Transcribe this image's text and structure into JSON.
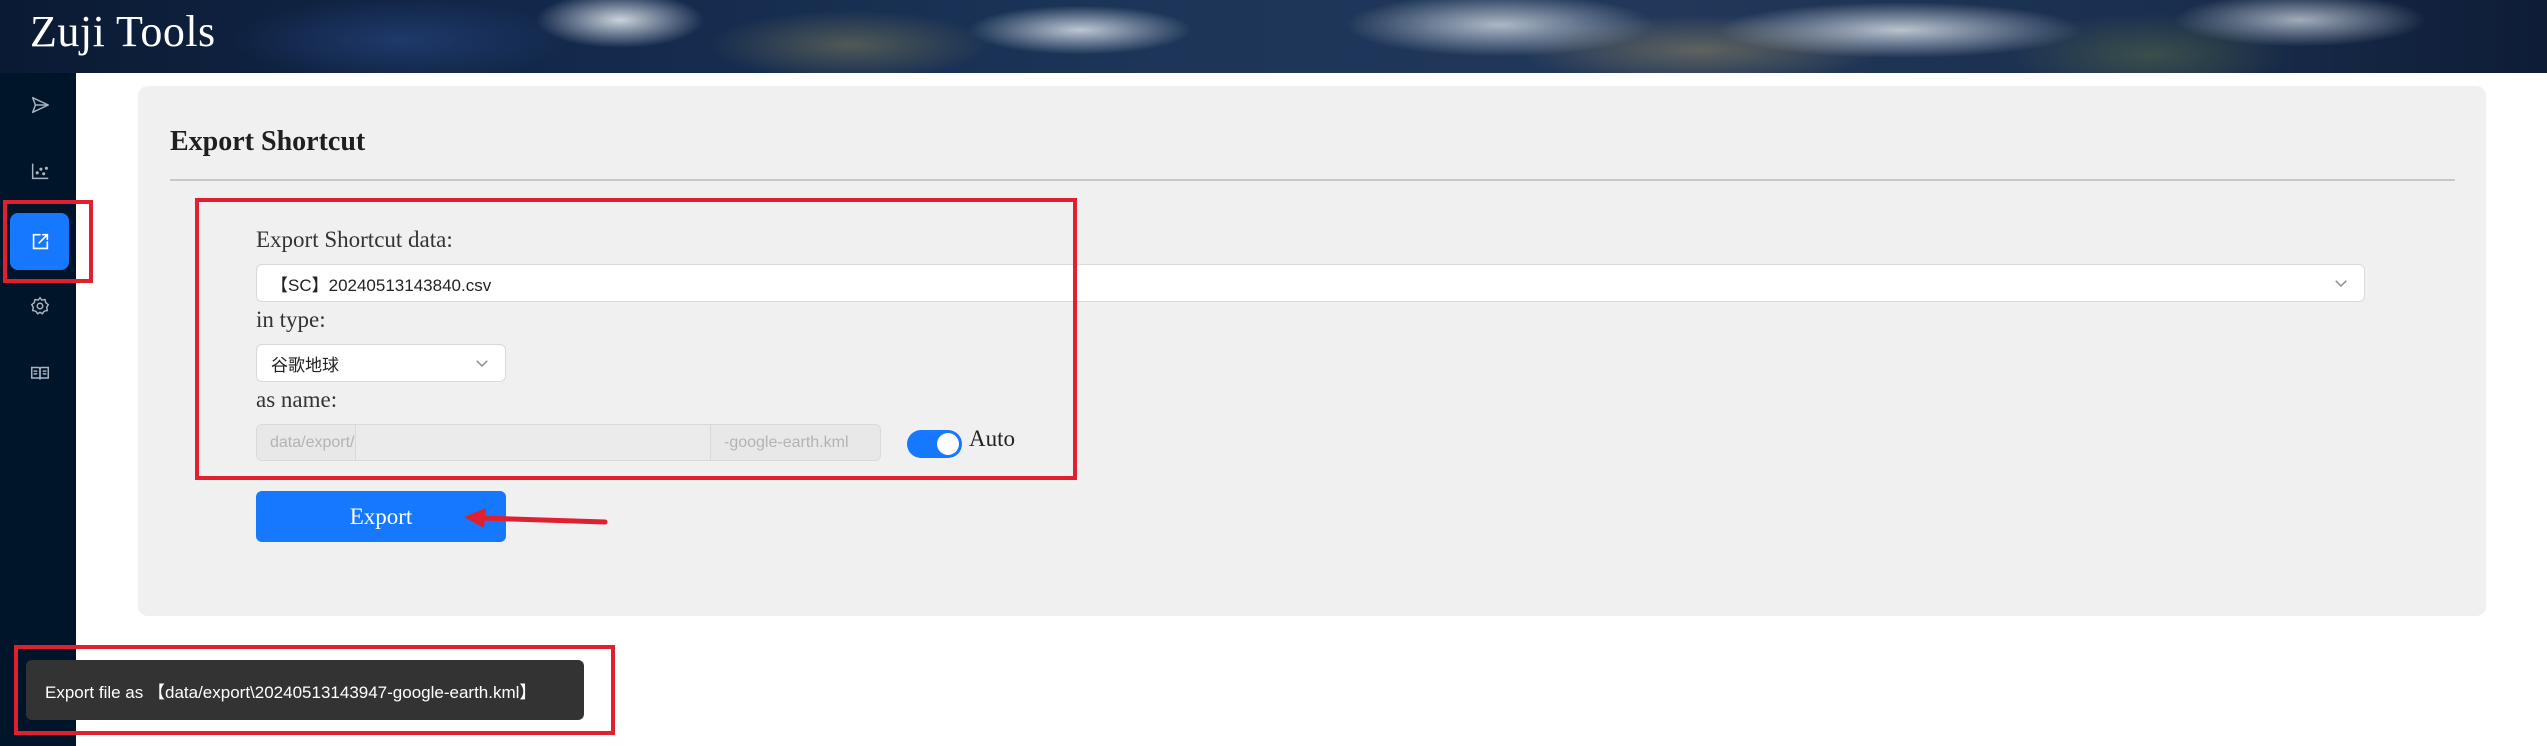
{
  "app": {
    "title": "Zuji Tools"
  },
  "sidebar": {
    "items": [
      {
        "icon": "send-icon",
        "active": false
      },
      {
        "icon": "scatter-chart-icon",
        "active": false
      },
      {
        "icon": "export-edit-icon",
        "active": true
      },
      {
        "icon": "settings-gear-icon",
        "active": false
      },
      {
        "icon": "book-icon",
        "active": false
      }
    ]
  },
  "card": {
    "title": "Export Shortcut",
    "data_label": "Export Shortcut data:",
    "data_value": "【SC】20240513143840.csv",
    "type_label": "in type:",
    "type_value": "谷歌地球",
    "name_label": "as name:",
    "name_prefix": "data/export/",
    "name_value": "",
    "name_suffix": "-google-earth.kml",
    "auto_label": "Auto",
    "auto_enabled": true,
    "export_label": "Export"
  },
  "toast": {
    "message": "Export file as 【data/export\\20240513143947-google-earth.kml】"
  },
  "colors": {
    "sidebar_bg": "#001529",
    "accent": "#1677ff",
    "card_bg": "#f0f0f0",
    "annotation": "#e0202e",
    "toast_bg": "#333333"
  }
}
